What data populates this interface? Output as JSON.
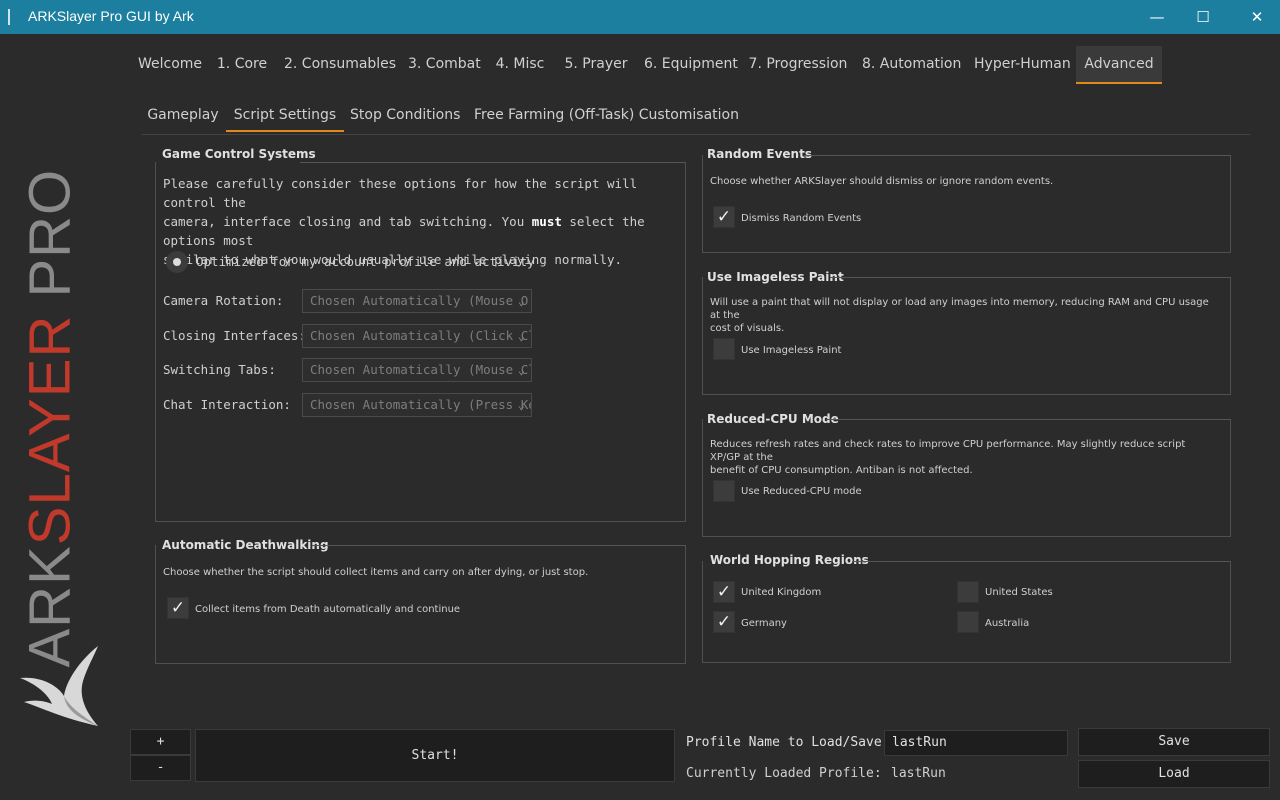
{
  "window": {
    "title": "ARKSlayer Pro GUI by Ark",
    "minimize_glyph": "—",
    "maximize_glyph": "☐",
    "close_glyph": "✕"
  },
  "brand": {
    "prefix": "ARK",
    "accent": "SLAYER",
    "suffix": " PRO",
    "accent_color": "#c0392b"
  },
  "main_tabs": [
    "Welcome",
    "1. Core",
    "2. Consumables",
    "3. Combat",
    "4. Misc",
    "5. Prayer",
    "6. Equipment",
    "7. Progression",
    "8. Automation",
    "Hyper-Human",
    "Advanced"
  ],
  "active_main_tab": "Advanced",
  "sub_tabs": [
    "Gameplay",
    "Script Settings",
    "Stop Conditions",
    "Free Farming (Off-Task) Customisation"
  ],
  "active_sub_tab": "Script Settings",
  "game_control": {
    "title": "Game Control Systems",
    "desc_line1": "Please carefully consider these options for how the script will control the",
    "desc_line2": "camera, interface closing and tab switching. You ",
    "desc_bold": "must",
    "desc_line2_end": " select the options most",
    "desc_line3": "similar to what you would usually use while playing normally.",
    "radio_label": "Optimized for my account profile and activity",
    "fields": [
      {
        "label": "Camera Rotation:",
        "value": "Chosen Automatically (Mouse O..."
      },
      {
        "label": "Closing Interfaces:",
        "value": "Chosen Automatically (Click Clos..."
      },
      {
        "label": "Switching Tabs:",
        "value": "Chosen Automatically (Mouse Cl..."
      },
      {
        "label": "Chat Interaction:",
        "value": "Chosen Automatically (Press Ke..."
      }
    ]
  },
  "deathwalking": {
    "title": "Automatic Deathwalking",
    "desc": "Choose whether the script should collect items and carry on after dying, or just stop.",
    "option": "Collect items from Death automatically and continue",
    "checked": true
  },
  "random_events": {
    "title": "Random Events",
    "desc": "Choose whether ARKSlayer should dismiss or ignore random events.",
    "option": "Dismiss Random Events",
    "checked": true
  },
  "imageless": {
    "title": "Use Imageless Paint",
    "desc_line1": "Will use a paint that will not display or load any images into memory, reducing RAM and CPU usage at the",
    "desc_line2": "cost of visuals.",
    "option": "Use Imageless Paint",
    "checked": false
  },
  "reduced_cpu": {
    "title": "Reduced-CPU Mode",
    "desc_line1": "Reduces refresh rates and check rates to improve CPU performance. May slightly reduce script XP/GP at the",
    "desc_line2": "benefit of CPU consumption. Antiban is not affected.",
    "option": "Use Reduced-CPU mode",
    "checked": false
  },
  "world_hopping": {
    "title": "World Hopping Regions",
    "regions": [
      {
        "name": "United Kingdom",
        "checked": true
      },
      {
        "name": "United States",
        "checked": false
      },
      {
        "name": "Germany",
        "checked": true
      },
      {
        "name": "Australia",
        "checked": false
      }
    ]
  },
  "bottom": {
    "plus": "+",
    "minus": "-",
    "start": "Start!",
    "profile_label": "Profile Name to Load/Save:",
    "profile_value": "lastRun",
    "current_label": "Currently Loaded Profile:",
    "current_value": "lastRun",
    "save": "Save",
    "load": "Load"
  },
  "colors": {
    "accent": "#e08a1a",
    "titlebar": "#1d7fa0",
    "background": "#2b2b2b"
  }
}
